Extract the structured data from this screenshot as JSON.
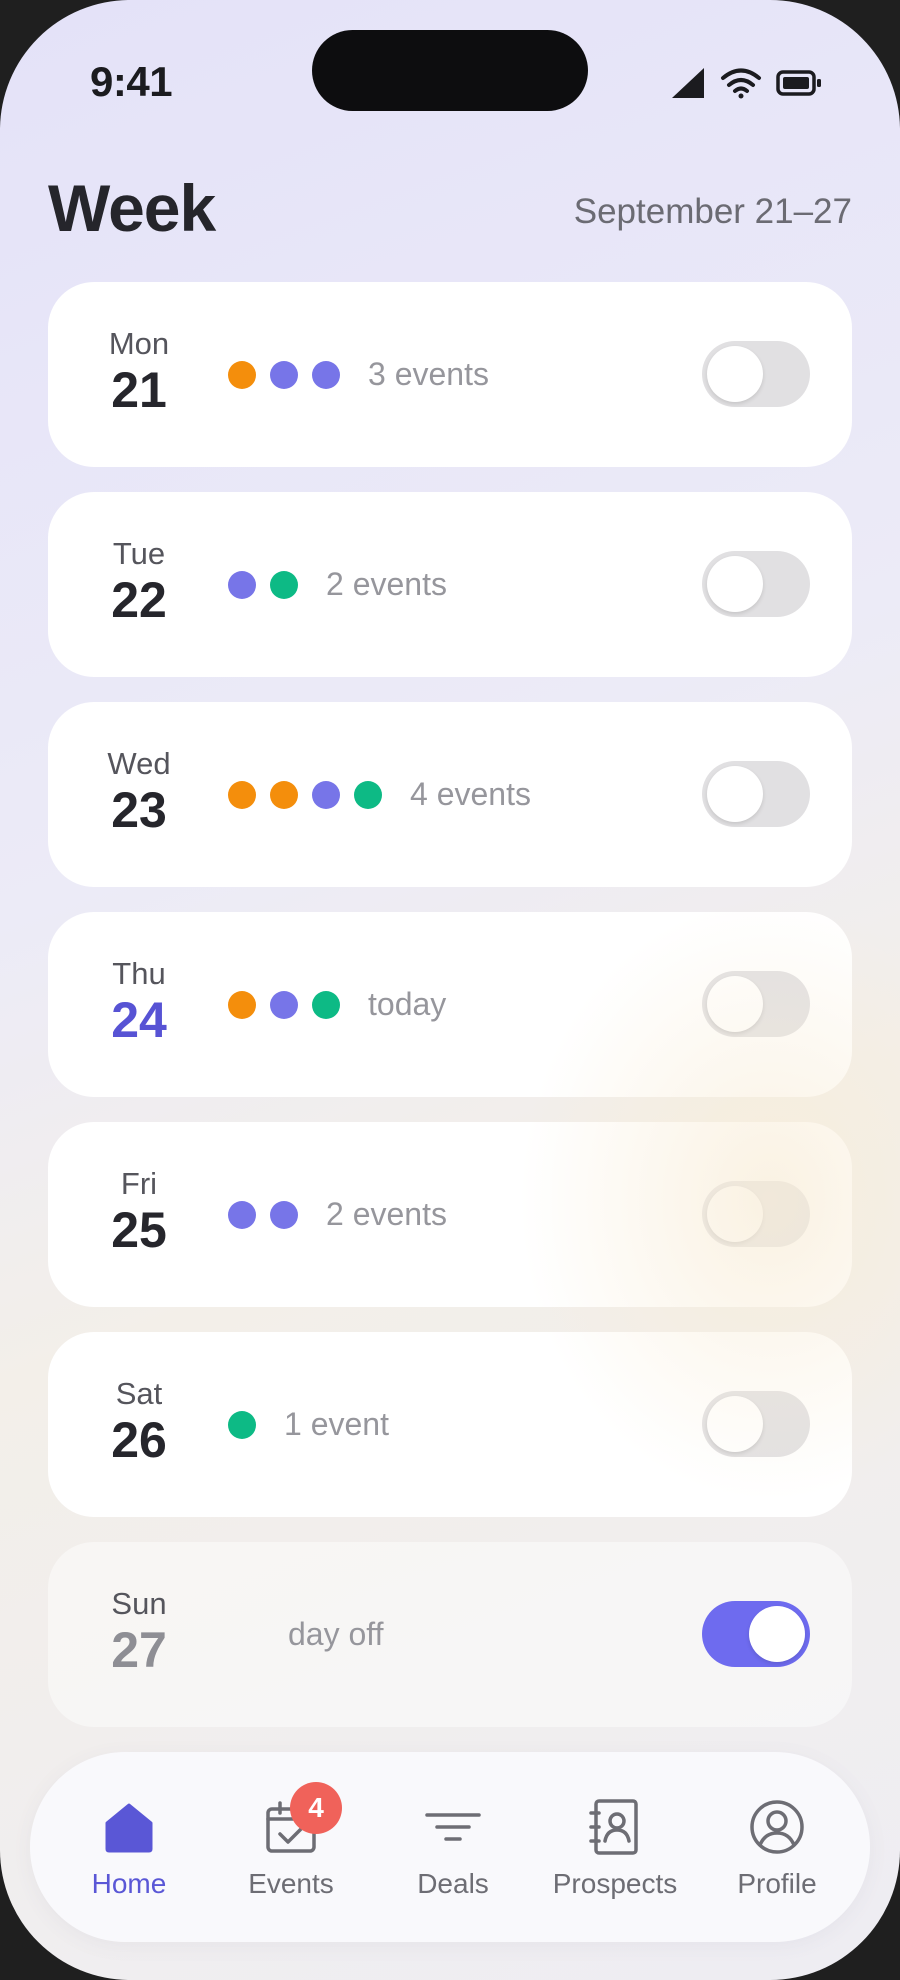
{
  "status_bar": {
    "time": "9:41"
  },
  "header": {
    "title": "Week",
    "date_range": "September 21–27"
  },
  "colors": {
    "orange": "#f48e0c",
    "purple": "#7775e8",
    "green": "#0dba85",
    "accent": "#5a57d6",
    "toggle_on": "#6e6bef",
    "badge": "#f0625a"
  },
  "days": [
    {
      "name": "Mon",
      "date": "21",
      "dots": [
        "orange",
        "purple",
        "purple"
      ],
      "summary": "3 events",
      "toggle_on": false
    },
    {
      "name": "Tue",
      "date": "22",
      "dots": [
        "purple",
        "green"
      ],
      "summary": "2 events",
      "toggle_on": false
    },
    {
      "name": "Wed",
      "date": "23",
      "dots": [
        "orange",
        "orange",
        "purple",
        "green"
      ],
      "summary": "4 events",
      "toggle_on": false
    },
    {
      "name": "Thu",
      "date": "24",
      "dots": [
        "orange",
        "purple",
        "green"
      ],
      "summary": "today",
      "toggle_on": false,
      "is_today": true
    },
    {
      "name": "Fri",
      "date": "25",
      "dots": [
        "purple",
        "purple"
      ],
      "summary": "2 events",
      "toggle_on": false
    },
    {
      "name": "Sat",
      "date": "26",
      "dots": [
        "green"
      ],
      "summary": "1 event",
      "toggle_on": false
    },
    {
      "name": "Sun",
      "date": "27",
      "dots": [],
      "summary": "day off",
      "toggle_on": true,
      "is_day_off": true
    }
  ],
  "tab_bar": {
    "tabs": [
      {
        "label": "Home",
        "icon": "home-icon",
        "active": true
      },
      {
        "label": "Events",
        "icon": "calendar-check-icon",
        "badge": "4"
      },
      {
        "label": "Deals",
        "icon": "filter-icon"
      },
      {
        "label": "Prospects",
        "icon": "contact-book-icon"
      },
      {
        "label": "Profile",
        "icon": "profile-icon"
      }
    ]
  }
}
